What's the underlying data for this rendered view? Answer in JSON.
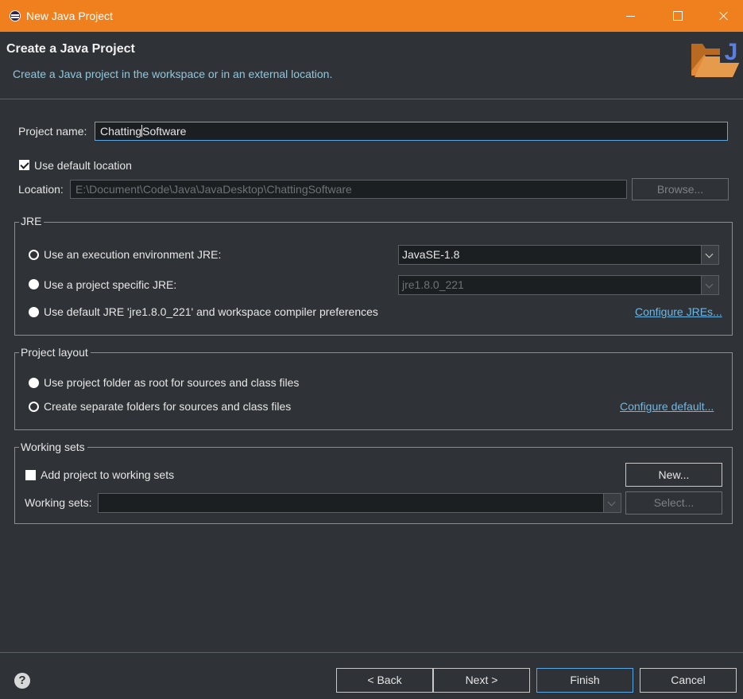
{
  "window": {
    "title": "New Java Project"
  },
  "banner": {
    "heading": "Create a Java Project",
    "description": "Create a Java project in the workspace or in an external location."
  },
  "project": {
    "name_label": "Project name:",
    "name_value_before_caret": "Chatting",
    "name_value_after_caret": "Software",
    "use_default_location_label": "Use default location",
    "use_default_location_checked": true,
    "location_label": "Location:",
    "location_value": "E:\\Document\\Code\\Java\\JavaDesktop\\ChattingSoftware",
    "browse_label": "Browse..."
  },
  "jre": {
    "group_title": "JRE",
    "option_env_label": "Use an execution environment JRE:",
    "option_env_selected": true,
    "env_value": "JavaSE-1.8",
    "option_specific_label": "Use a project specific JRE:",
    "specific_value": "jre1.8.0_221",
    "option_default_label": "Use default JRE 'jre1.8.0_221' and workspace compiler preferences",
    "configure_link": "Configure JREs..."
  },
  "layout": {
    "group_title": "Project layout",
    "option_root_label": "Use project folder as root for sources and class files",
    "option_separate_label": "Create separate folders for sources and class files",
    "option_separate_selected": true,
    "configure_link": "Configure default..."
  },
  "working_sets": {
    "group_title": "Working sets",
    "add_label": "Add project to working sets",
    "add_checked": false,
    "new_label": "New...",
    "sets_label": "Working sets:",
    "sets_value": "",
    "select_label": "Select..."
  },
  "footer": {
    "help_glyph": "?",
    "back_label": "< Back",
    "next_label": "Next >",
    "finish_label": "Finish",
    "cancel_label": "Cancel"
  },
  "colors": {
    "titlebar": "#f07f1e",
    "background": "#2f3337",
    "link": "#6fb7e5",
    "focus": "#5aa9e6"
  }
}
